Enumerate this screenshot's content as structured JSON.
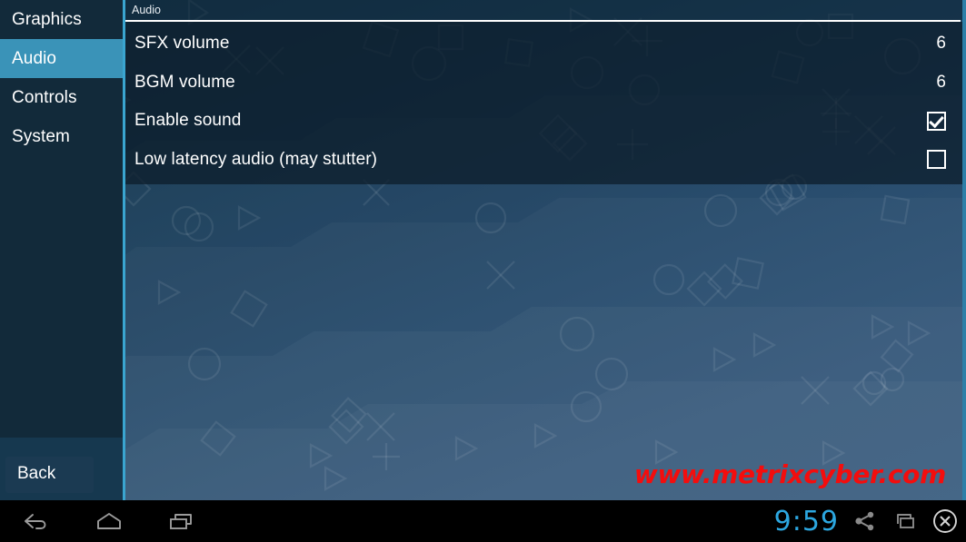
{
  "sidebar": {
    "items": [
      {
        "label": "Graphics",
        "selected": false
      },
      {
        "label": "Audio",
        "selected": true
      },
      {
        "label": "Controls",
        "selected": false
      },
      {
        "label": "System",
        "selected": false
      }
    ],
    "back_label": "Back"
  },
  "panel": {
    "title": "Audio",
    "rows": [
      {
        "label": "SFX volume",
        "type": "value",
        "value": "6"
      },
      {
        "label": "BGM volume",
        "type": "value",
        "value": "6"
      },
      {
        "label": "Enable sound",
        "type": "checkbox",
        "checked": true
      },
      {
        "label": "Low latency audio (may stutter)",
        "type": "checkbox",
        "checked": false
      }
    ]
  },
  "watermark": {
    "text": "www.metrixcyber.com",
    "color": "#f40d0d"
  },
  "navbar": {
    "back_icon": "back-arrow-icon",
    "home_icon": "home-icon",
    "recents_icon": "recent-apps-icon",
    "clock": "9:59",
    "share_icon": "share-icon",
    "cast_icon": "cast-window-icon",
    "close_icon": "close-circle-icon",
    "clock_color": "#2ca7e0"
  },
  "theme": {
    "accent": "#3a93b8",
    "divider": "#3aa5d0",
    "sidebar_bg": "#122a3a",
    "panel_bg": "#0c1c2a",
    "bg_dark": "#153349",
    "bg_light": "#2d5478"
  }
}
